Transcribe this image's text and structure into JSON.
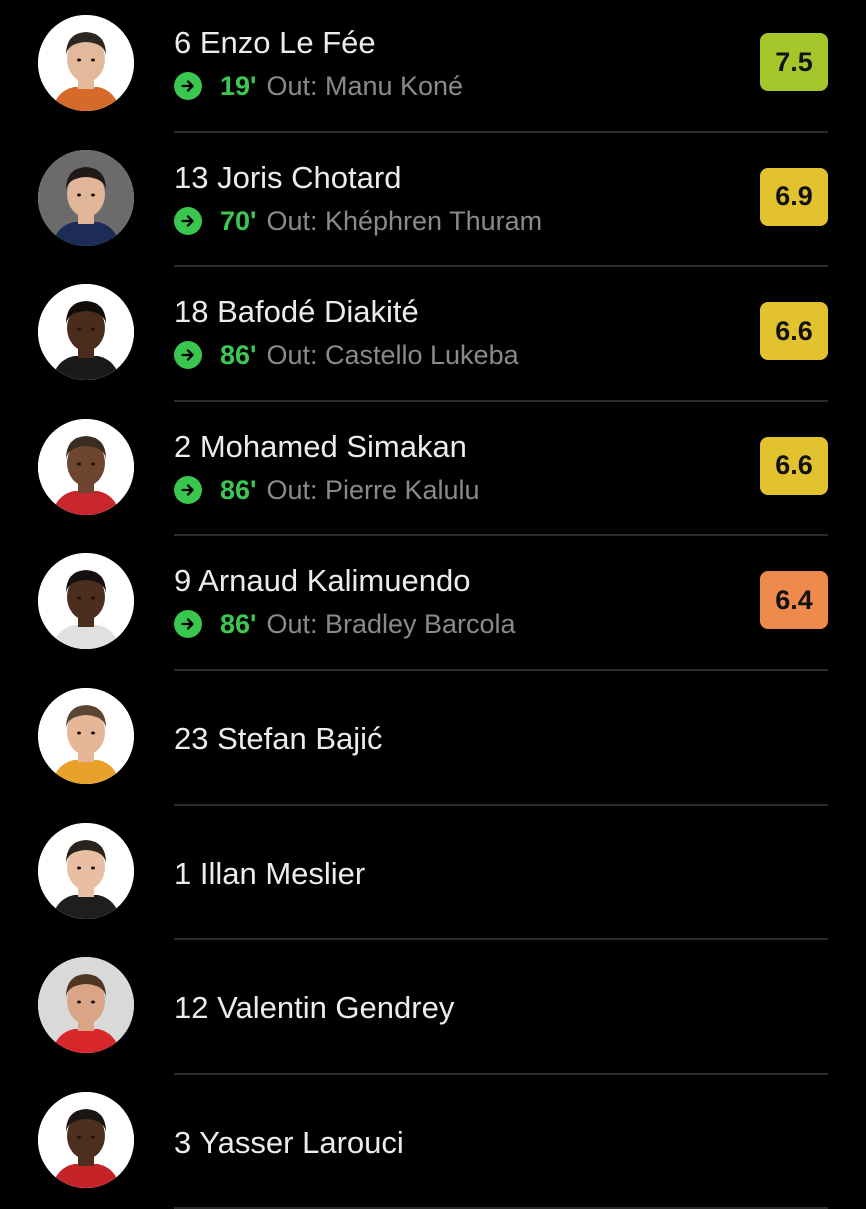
{
  "colors": {
    "background": "#000000",
    "divider": "#2b2b2b",
    "sub_in": "#39c74f",
    "rating_green": "#a5c62a",
    "rating_yellow": "#e3c22f",
    "rating_orange": "#ee8a4c"
  },
  "players": [
    {
      "name": "6 Enzo Le Fée",
      "sub": {
        "icon": "sub-in-arrow-icon",
        "minute": "19'",
        "out": "Out: Manu Koné"
      },
      "rating": "7.5",
      "rating_color": "#a5c62a",
      "avatar": {
        "skin": "#e3b99b",
        "hair": "#2e2620",
        "shirt": "#d66a2a",
        "bg": "#ffffff"
      }
    },
    {
      "name": "13 Joris Chotard",
      "sub": {
        "icon": "sub-in-arrow-icon",
        "minute": "70'",
        "out": "Out: Khéphren Thuram"
      },
      "rating": "6.9",
      "rating_color": "#e3c22f",
      "avatar": {
        "skin": "#e1b597",
        "hair": "#1f1a17",
        "shirt": "#1c2c56",
        "bg": "#6b6b6b"
      }
    },
    {
      "name": "18 Bafodé Diakité",
      "sub": {
        "icon": "sub-in-arrow-icon",
        "minute": "86'",
        "out": "Out: Castello Lukeba"
      },
      "rating": "6.6",
      "rating_color": "#e3c22f",
      "avatar": {
        "skin": "#4a2c1c",
        "hair": "#120c09",
        "shirt": "#1a1a1a",
        "bg": "#ffffff"
      }
    },
    {
      "name": "2 Mohamed Simakan",
      "sub": {
        "icon": "sub-in-arrow-icon",
        "minute": "86'",
        "out": "Out: Pierre Kalulu"
      },
      "rating": "6.6",
      "rating_color": "#e3c22f",
      "avatar": {
        "skin": "#6e4630",
        "hair": "#3c2c20",
        "shirt": "#c9252d",
        "bg": "#ffffff"
      }
    },
    {
      "name": "9 Arnaud Kalimuendo",
      "sub": {
        "icon": "sub-in-arrow-icon",
        "minute": "86'",
        "out": "Out: Bradley Barcola"
      },
      "rating": "6.4",
      "rating_color": "#ee8a4c",
      "avatar": {
        "skin": "#4b2e1e",
        "hair": "#151010",
        "shirt": "#e0e0e0",
        "bg": "#ffffff"
      }
    },
    {
      "name": "23 Stefan Bajić",
      "avatar": {
        "skin": "#e6b697",
        "hair": "#5b4634",
        "shirt": "#e8a12a",
        "bg": "#ffffff"
      }
    },
    {
      "name": "1 Illan Meslier",
      "avatar": {
        "skin": "#e8bfa3",
        "hair": "#2a221d",
        "shirt": "#1e1e1e",
        "bg": "#ffffff"
      }
    },
    {
      "name": "12 Valentin Gendrey",
      "avatar": {
        "skin": "#d9a586",
        "hair": "#4f3524",
        "shirt": "#d8272a",
        "bg": "#d9d9d9"
      }
    },
    {
      "name": "3 Yasser Larouci",
      "avatar": {
        "skin": "#4d2f20",
        "hair": "#1a1412",
        "shirt": "#c62328",
        "bg": "#ffffff"
      }
    }
  ]
}
